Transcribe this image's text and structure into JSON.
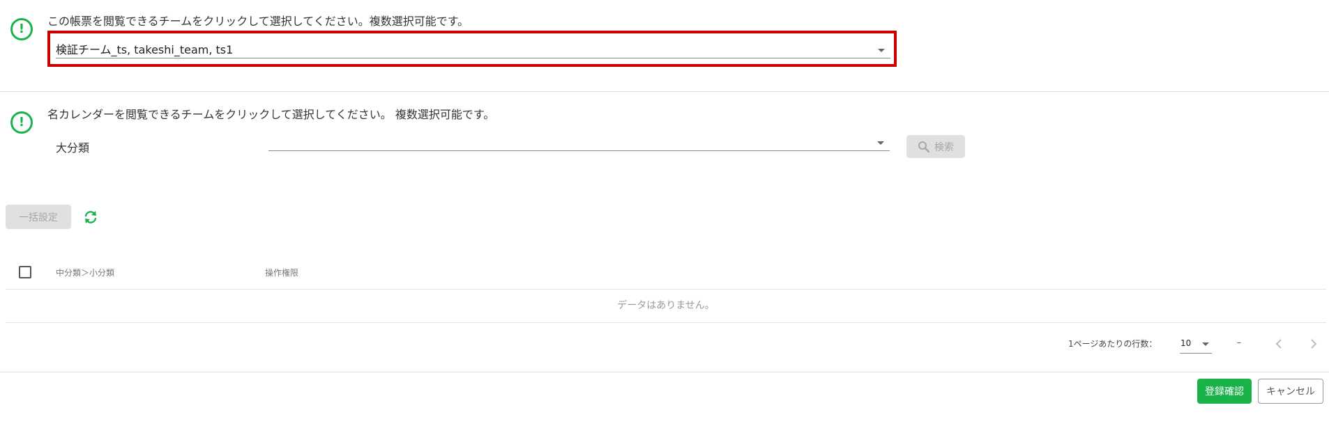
{
  "team_section": {
    "instruction": "この帳票を閲覧できるチームをクリックして選択してください。複数選択可能です。",
    "selected_value": "検証チーム_ts, takeshi_team, ts1"
  },
  "calendar_section": {
    "instruction": "名カレンダーを閲覧できるチームをクリックして選択してください。 複数選択可能です。",
    "category_label": "大分類",
    "category_value": "",
    "search_label": "検索"
  },
  "toolbar": {
    "bulk_setting_label": "一括設定"
  },
  "table": {
    "columns": [
      "中分類＞小分類",
      "操作権限"
    ],
    "empty_message": "データはありません。"
  },
  "pagination": {
    "rows_per_page_label": "1ページあたりの行数：",
    "rows_per_page_value": "10",
    "range_text": "–"
  },
  "footer": {
    "confirm_label": "登録確認",
    "cancel_label": "キャンセル"
  },
  "colors": {
    "accent": "#19b34a",
    "highlight": "#cc0000"
  }
}
